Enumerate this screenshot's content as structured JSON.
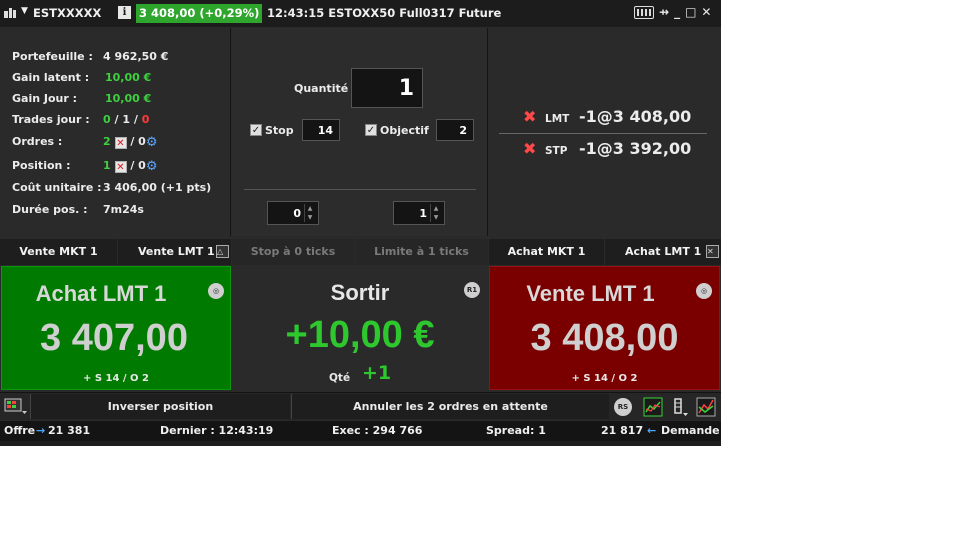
{
  "titlebar": {
    "symbol": "ESTXXXXX",
    "caret": "▼",
    "info": "i",
    "price_change": "3 408,00 (+0,29%)",
    "time_contract": "12:43:15 ESTOXX50 Full0317 Future",
    "minimize": "_",
    "maximize": "□",
    "close": "✕",
    "pin": "⇸"
  },
  "account": {
    "portefeuille_label": "Portefeuille :",
    "portefeuille_value": "4 962,50 €",
    "gain_latent_label": "Gain latent :",
    "gain_latent_value": "10,00 €",
    "gain_jour_label": "Gain Jour :",
    "gain_jour_value": "10,00 €",
    "trades_label": "Trades jour :",
    "trades_a": "0",
    "trades_sep1": " / ",
    "trades_b": "1",
    "trades_sep2": " / ",
    "trades_c": "0",
    "ordres_label": "Ordres :",
    "ordres_count": "2",
    "ordres_other": " / 0",
    "position_label": "Position :",
    "position_count": "1",
    "position_other": " / 0",
    "cout_label": "Coût unitaire :",
    "cout_value": "3 406,00 (+1 pts)",
    "duree_label": "Durée pos. :",
    "duree_value": "7m24s"
  },
  "order_entry": {
    "quantite_label": "Quantité",
    "quantite_value": "1",
    "stop_label": "Stop",
    "stop_value": "14",
    "objectif_label": "Objectif",
    "objectif_value": "2",
    "spin_left": "0",
    "spin_right": "1",
    "check": "✓"
  },
  "working_orders": [
    {
      "type": "LMT",
      "value": "-1@3 408,00"
    },
    {
      "type": "STP",
      "value": "-1@3 392,00"
    }
  ],
  "action_bar": {
    "vente_mkt": "Vente MKT 1",
    "vente_lmt": "Vente LMT 1",
    "stop_ticks": "Stop à 0 ticks",
    "limite_ticks": "Limite à 1 ticks",
    "achat_mkt": "Achat MKT 1",
    "achat_lmt": "Achat LMT 1"
  },
  "tiles": {
    "buy_title": "Achat LMT 1",
    "buy_price": "3 407,00",
    "buy_sub": "+ S 14 / O 2",
    "exit_title": "Sortir",
    "exit_pnl": "+10,00 €",
    "exit_qte_label": "Qté",
    "exit_qte_value": "+1",
    "exit_icon": "R1",
    "sell_title": "Vente LMT 1",
    "sell_price": "3 408,00",
    "sell_sub": "+ S 14 / O 2"
  },
  "toolbar": {
    "inverser": "Inverser position",
    "annuler": "Annuler les 2 ordres en attente",
    "rs_icon": "RS"
  },
  "status": {
    "offre_label": "Offre",
    "offre_value": "21 381",
    "dernier": "Dernier : 12:43:19",
    "exec": "Exec : 294 766",
    "spread": "Spread: 1",
    "demande_value": "21 817",
    "demande_label": "Demande"
  },
  "colors": {
    "buy_bg": "#007a00",
    "sell_bg": "#7a0000",
    "gain_green": "#3ed13e",
    "price_badge": "#2ea62e"
  }
}
